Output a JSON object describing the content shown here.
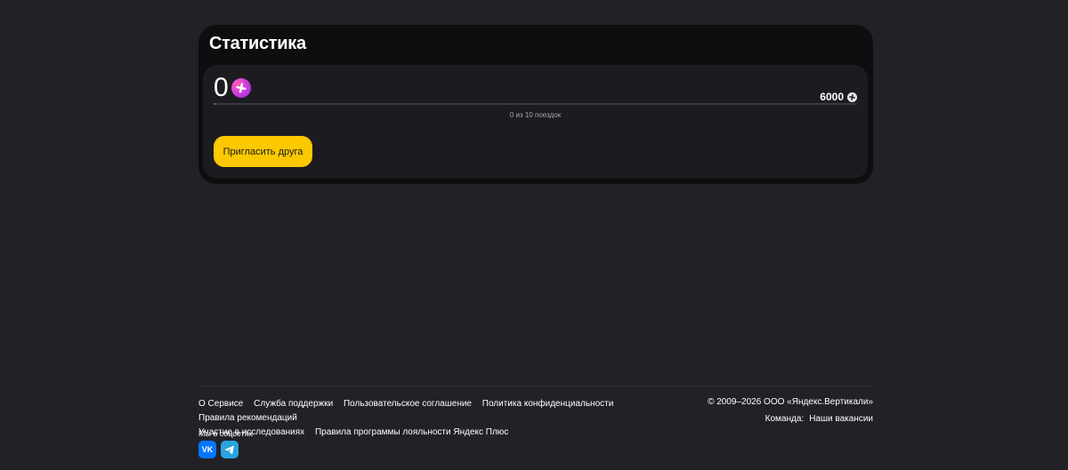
{
  "stats": {
    "title": "Статистика",
    "points": "0",
    "goal": "6000",
    "progress_fraction": 0,
    "progress_caption": "0 из 10 поездок",
    "invite_label": "Пригласить друга"
  },
  "footer": {
    "links": [
      "О Сервисе",
      "Служба поддержки",
      "Пользовательское соглашение",
      "Политика конфиденциальности",
      "Правила рекомендаций",
      "Участие в исследованиях",
      "Правила программы лояльности Яндекс Плюс"
    ],
    "copyright": "© 2009–2026 ООО «Яндекс.Вертикали»",
    "team_label": "Команда:",
    "vacancies_label": "Наши вакансии",
    "social_label": "Мы в соцсетях",
    "social": {
      "vk": "VK",
      "telegram": "telegram-icon"
    }
  },
  "colors": {
    "background": "#222126",
    "card": "#0e0e10",
    "inner_card": "#1c1b20",
    "accent_button": "#fcc800",
    "plus_gradient_start": "#ff5ab4",
    "plus_gradient_end": "#8a33e8",
    "vk": "#0077ff",
    "telegram": "#2aa3e0"
  }
}
